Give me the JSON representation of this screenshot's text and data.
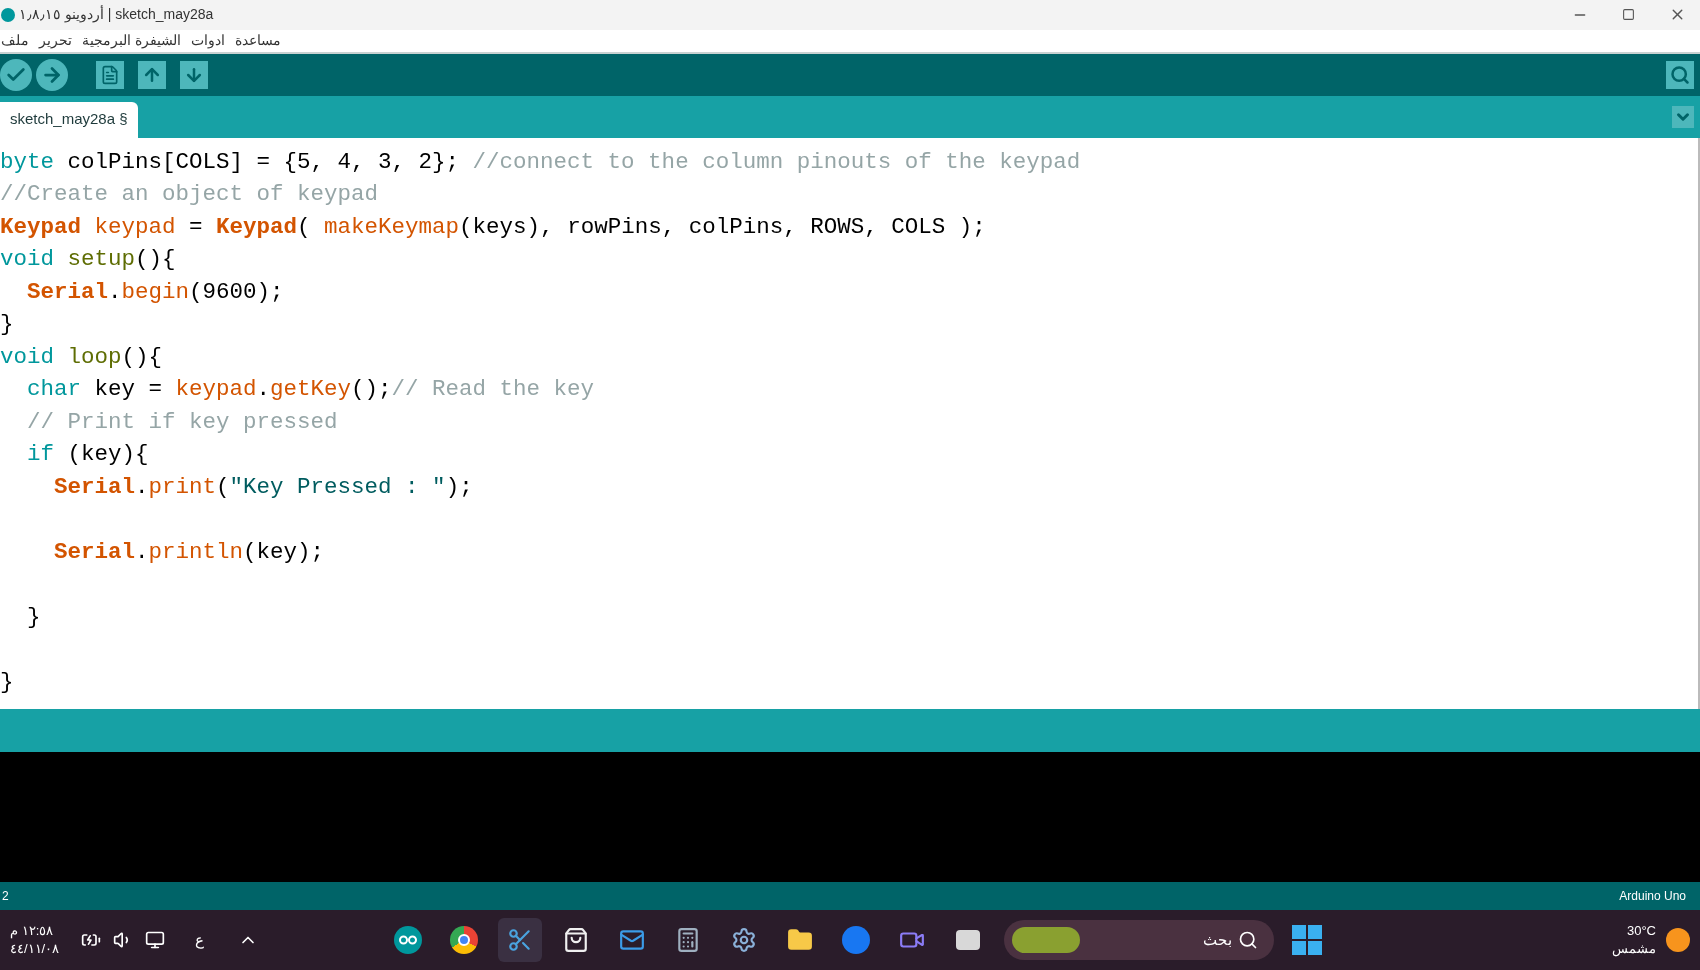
{
  "window": {
    "title": "أردوينو ١٫٨٫١٥ | sketch_may28a"
  },
  "menu": [
    "مساعدة",
    "ادوات",
    "الشيفرة البرمجية",
    "تحرير",
    "ملف"
  ],
  "tabs": [
    {
      "label": "sketch_may28a §",
      "selected": true
    }
  ],
  "code": [
    {
      "kind": "code",
      "tokens": [
        {
          "t": "byte",
          "kind": "keyword"
        },
        {
          "t": " colPins[COLS] = {5, 4, 3, 2}; ",
          "kind": "plain"
        },
        {
          "t": "//connect to the column pinouts of the keypad",
          "kind": "comment"
        }
      ]
    },
    {
      "kind": "code",
      "tokens": [
        {
          "t": "//Create an object of keypad",
          "kind": "comment"
        }
      ]
    },
    {
      "kind": "code",
      "tokens": [
        {
          "t": "Keypad ",
          "kind": "class"
        },
        {
          "t": "keypad",
          "kind": "method"
        },
        {
          "t": " = ",
          "kind": "plain"
        },
        {
          "t": "Keypad",
          "kind": "class"
        },
        {
          "t": "( ",
          "kind": "plain"
        },
        {
          "t": "makeKeymap",
          "kind": "method"
        },
        {
          "t": "(keys), rowPins, colPins, ROWS, COLS );",
          "kind": "plain"
        }
      ]
    },
    {
      "kind": "code",
      "tokens": [
        {
          "t": "void ",
          "kind": "keyword"
        },
        {
          "t": "setup",
          "kind": "func"
        },
        {
          "t": "(){",
          "kind": "plain"
        }
      ]
    },
    {
      "kind": "code",
      "tokens": [
        {
          "t": "  Serial",
          "kind": "class"
        },
        {
          "t": ".",
          "kind": "plain"
        },
        {
          "t": "begin",
          "kind": "method"
        },
        {
          "t": "(9600);",
          "kind": "plain"
        }
      ]
    },
    {
      "kind": "code",
      "tokens": [
        {
          "t": "}",
          "kind": "plain"
        }
      ]
    },
    {
      "kind": "code",
      "tokens": [
        {
          "t": "void ",
          "kind": "keyword"
        },
        {
          "t": "loop",
          "kind": "func"
        },
        {
          "t": "(){",
          "kind": "plain"
        }
      ]
    },
    {
      "kind": "code",
      "tokens": [
        {
          "t": "  char",
          "kind": "keyword"
        },
        {
          "t": " key = ",
          "kind": "plain"
        },
        {
          "t": "keypad",
          "kind": "method"
        },
        {
          "t": ".",
          "kind": "plain"
        },
        {
          "t": "getKey",
          "kind": "method"
        },
        {
          "t": "();",
          "kind": "plain"
        },
        {
          "t": "// Read the key",
          "kind": "comment"
        }
      ]
    },
    {
      "kind": "code",
      "tokens": [
        {
          "t": "  // Print if key pressed",
          "kind": "comment"
        }
      ]
    },
    {
      "kind": "code",
      "tokens": [
        {
          "t": "  if",
          "kind": "keyword"
        },
        {
          "t": " (key){",
          "kind": "plain"
        }
      ]
    },
    {
      "kind": "code",
      "tokens": [
        {
          "t": "    Serial",
          "kind": "class"
        },
        {
          "t": ".",
          "kind": "plain"
        },
        {
          "t": "print",
          "kind": "method"
        },
        {
          "t": "(",
          "kind": "plain"
        },
        {
          "t": "\"Key Pressed : \"",
          "kind": "string"
        },
        {
          "t": ");",
          "kind": "plain"
        }
      ]
    },
    {
      "kind": "blank"
    },
    {
      "kind": "code",
      "tokens": [
        {
          "t": "    Serial",
          "kind": "class"
        },
        {
          "t": ".",
          "kind": "plain"
        },
        {
          "t": "println",
          "kind": "method"
        },
        {
          "t": "(key);",
          "kind": "plain"
        }
      ]
    },
    {
      "kind": "blank"
    },
    {
      "kind": "code",
      "tokens": [
        {
          "t": "  }",
          "kind": "plain"
        }
      ]
    },
    {
      "kind": "blank"
    },
    {
      "kind": "code",
      "tokens": [
        {
          "t": "}",
          "kind": "plain"
        }
      ]
    }
  ],
  "status_bar": {
    "line": "2",
    "board": "Arduino Uno"
  },
  "taskbar": {
    "time": "١٢:٥٨ م",
    "date": "٤٤/١١/٠٨",
    "language": "ع",
    "search": {
      "placeholder": "بحث"
    },
    "weather": {
      "temperature": "30°C",
      "condition": "مشمس"
    }
  }
}
